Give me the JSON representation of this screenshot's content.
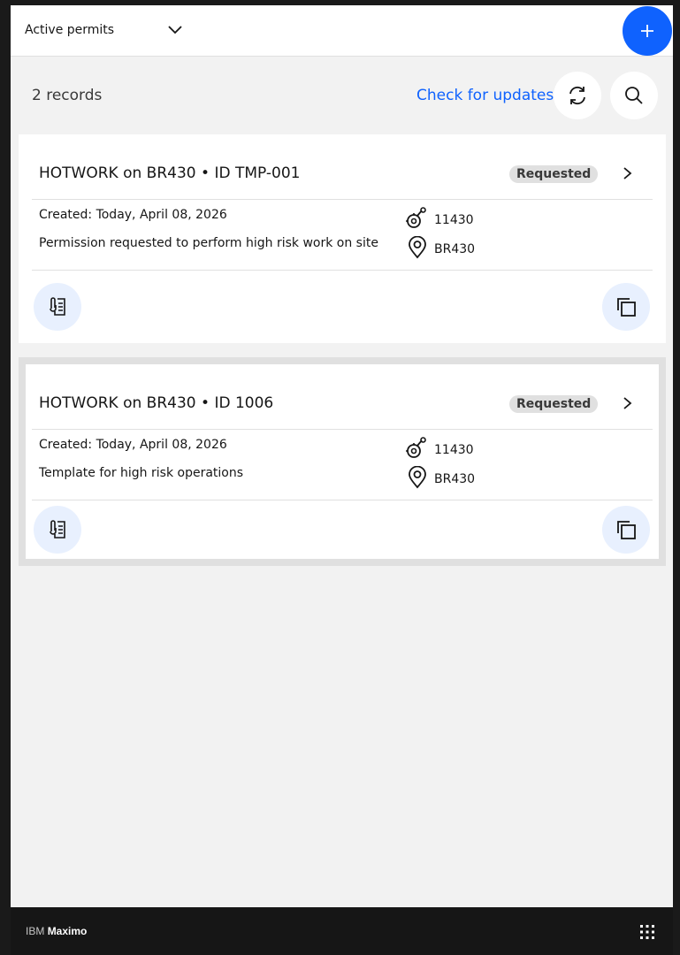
{
  "header": {
    "filter_label": "Active permits",
    "add_label": "+"
  },
  "records": {
    "count_text": "2 records",
    "check_updates_label": "Check for updates"
  },
  "cards": [
    {
      "title": "HOTWORK on BR430 • ID TMP-001",
      "status": "Requested",
      "created": "Created: Today, April 08, 2026",
      "description": "Permission requested to perform high risk work on site",
      "asset": "11430",
      "location": "BR430"
    },
    {
      "title": "HOTWORK on BR430 • ID 1006",
      "status": "Requested",
      "created": "Created: Today, April 08, 2026",
      "description": "Template for high risk operations",
      "asset": "11430",
      "location": "BR430"
    }
  ],
  "footer": {
    "brand_prefix": "IBM",
    "brand_name": "Maximo"
  },
  "icons": {
    "filter": "chevron-down-icon",
    "add": "plus-icon",
    "refresh": "refresh-icon",
    "search": "search-icon",
    "open": "chevron-right-icon",
    "asset": "asset-icon",
    "location": "location-pin-icon",
    "attachments": "attachment-document-icon",
    "duplicate": "copy-icon",
    "apps": "app-grid-icon"
  },
  "colors": {
    "accent": "#0f62fe",
    "background": "#f2f2f2",
    "badge": "#e0e0e0",
    "footer": "#161616"
  }
}
